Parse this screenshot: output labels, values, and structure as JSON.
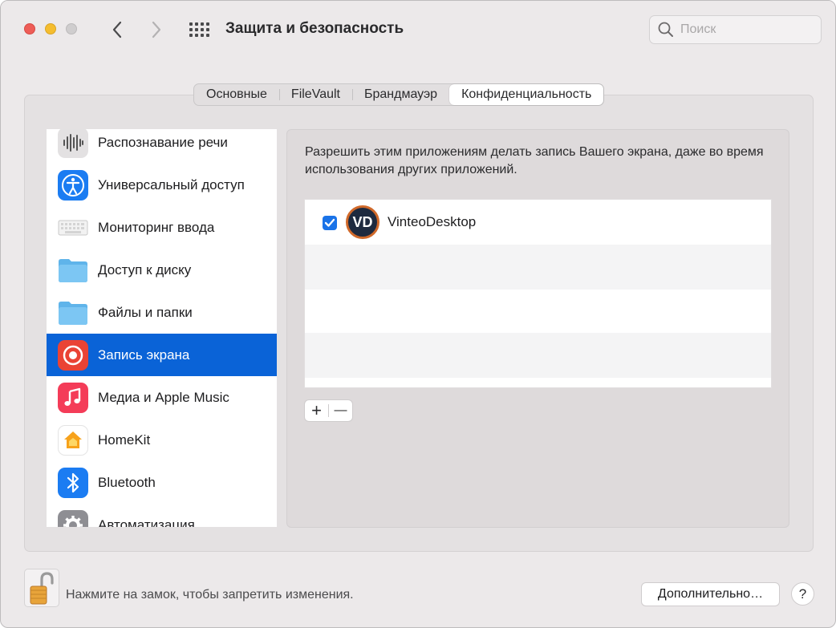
{
  "window": {
    "title": "Защита и безопасность"
  },
  "search": {
    "placeholder": "Поиск"
  },
  "tabs": [
    {
      "label": "Основные"
    },
    {
      "label": "FileVault"
    },
    {
      "label": "Брандмауэр"
    },
    {
      "label": "Конфиденциальность",
      "active": true
    }
  ],
  "sidebar": {
    "items": [
      {
        "label": "Распознавание речи",
        "icon": "waveform-icon"
      },
      {
        "label": "Универсальный доступ",
        "icon": "accessibility-icon"
      },
      {
        "label": "Мониторинг ввода",
        "icon": "keyboard-icon"
      },
      {
        "label": "Доступ к диску",
        "icon": "folder-icon"
      },
      {
        "label": "Файлы и папки",
        "icon": "folder-icon"
      },
      {
        "label": "Запись экрана",
        "icon": "screen-record-icon",
        "selected": true
      },
      {
        "label": "Медиа и Apple Music",
        "icon": "music-note-icon"
      },
      {
        "label": "HomeKit",
        "icon": "home-icon"
      },
      {
        "label": "Bluetooth",
        "icon": "bluetooth-icon"
      },
      {
        "label": "Автоматизация",
        "icon": "gear-icon"
      }
    ]
  },
  "panel": {
    "description": "Разрешить этим приложениям делать запись Вашего экрана, даже во время использования других приложений.",
    "apps": [
      {
        "name": "VinteoDesktop",
        "icon_text": "VD",
        "checked": true
      }
    ]
  },
  "controls": {
    "add": "+",
    "remove": "—"
  },
  "footer": {
    "lock_text": "Нажмите на замок, чтобы запретить изменения.",
    "advanced_label": "Дополнительно…",
    "help_label": "?"
  },
  "colors": {
    "selection": "#0a63d7",
    "checkbox": "#1a73e8",
    "close": "#ee5d57",
    "minimize": "#f5bd2f"
  }
}
